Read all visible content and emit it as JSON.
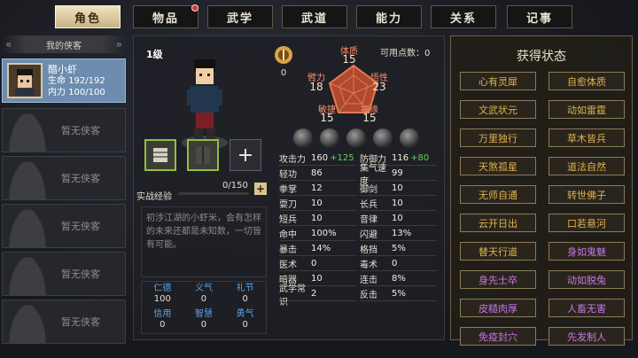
{
  "tabs": [
    {
      "label": "角色",
      "active": true,
      "badge": false
    },
    {
      "label": "物品",
      "active": false,
      "badge": true
    },
    {
      "label": "武学",
      "active": false,
      "badge": false
    },
    {
      "label": "武道",
      "active": false,
      "badge": false
    },
    {
      "label": "能力",
      "active": false,
      "badge": false
    },
    {
      "label": "关系",
      "active": false,
      "badge": false
    },
    {
      "label": "记事",
      "active": false,
      "badge": false
    }
  ],
  "sidebar": {
    "header": "我的侠客",
    "selected": {
      "name": "醋小虾",
      "life_label": "生命",
      "life_value": "192/192",
      "mana_label": "内力",
      "mana_value": "100/100"
    },
    "empty_label": "暂无侠客"
  },
  "character": {
    "level": "1级",
    "badge_value": "0",
    "available_points_label": "可用点数：",
    "available_points": "0",
    "stats": {
      "tizhi": {
        "name": "体质",
        "value": "15"
      },
      "biili": {
        "name": "臂力",
        "value": "18"
      },
      "wuxing": {
        "name": "悟性",
        "value": "23"
      },
      "minjie": {
        "name": "敏捷",
        "value": "15"
      },
      "fuyuan": {
        "name": "福缘",
        "value": "15"
      }
    },
    "exp": {
      "label": "实战经验",
      "value": "0/150",
      "progress": 0.0
    },
    "description": "初涉江湖的小虾米，会有怎样的未来还都是未知数，一切皆有可能。",
    "virtues": [
      {
        "name": "仁德",
        "value": "100"
      },
      {
        "name": "义气",
        "value": "0"
      },
      {
        "name": "礼节",
        "value": "0"
      },
      {
        "name": "信用",
        "value": "0"
      },
      {
        "name": "智慧",
        "value": "0"
      },
      {
        "name": "勇气",
        "value": "0"
      }
    ],
    "attributes": [
      {
        "name": "攻击力",
        "value": "160",
        "bonus": "+125"
      },
      {
        "name": "防御力",
        "value": "116",
        "bonus": "+80"
      },
      {
        "name": "轻功",
        "value": "86",
        "bonus": ""
      },
      {
        "name": "集气速度",
        "value": "99",
        "bonus": ""
      },
      {
        "name": "拳掌",
        "value": "12",
        "bonus": ""
      },
      {
        "name": "御剑",
        "value": "10",
        "bonus": ""
      },
      {
        "name": "耍刀",
        "value": "10",
        "bonus": ""
      },
      {
        "name": "长兵",
        "value": "10",
        "bonus": ""
      },
      {
        "name": "短兵",
        "value": "10",
        "bonus": ""
      },
      {
        "name": "音律",
        "value": "10",
        "bonus": ""
      },
      {
        "name": "命中",
        "value": "100%",
        "bonus": ""
      },
      {
        "name": "闪避",
        "value": "13%",
        "bonus": ""
      },
      {
        "name": "暴击",
        "value": "14%",
        "bonus": ""
      },
      {
        "name": "格挡",
        "value": "5%",
        "bonus": ""
      },
      {
        "name": "医术",
        "value": "0",
        "bonus": ""
      },
      {
        "name": "毒术",
        "value": "0",
        "bonus": ""
      },
      {
        "name": "暗器",
        "value": "10",
        "bonus": ""
      },
      {
        "name": "连击",
        "value": "8%",
        "bonus": ""
      },
      {
        "name": "武学常识",
        "value": "2",
        "bonus": ""
      },
      {
        "name": "反击",
        "value": "5%",
        "bonus": ""
      }
    ]
  },
  "states": {
    "title": "获得状态",
    "items": [
      {
        "label": "心有灵犀",
        "color": "gold"
      },
      {
        "label": "自愈体质",
        "color": "gold"
      },
      {
        "label": "文武状元",
        "color": "gold"
      },
      {
        "label": "动如雷霆",
        "color": "gold"
      },
      {
        "label": "万里独行",
        "color": "gold"
      },
      {
        "label": "草木皆兵",
        "color": "gold"
      },
      {
        "label": "天煞孤星",
        "color": "gold"
      },
      {
        "label": "道法自然",
        "color": "gold"
      },
      {
        "label": "无师自通",
        "color": "gold"
      },
      {
        "label": "转世佛子",
        "color": "gold"
      },
      {
        "label": "云开日出",
        "color": "gold"
      },
      {
        "label": "口若悬河",
        "color": "gold"
      },
      {
        "label": "替天行道",
        "color": "gold"
      },
      {
        "label": "身如鬼魅",
        "color": "purple"
      },
      {
        "label": "身先士卒",
        "color": "purple"
      },
      {
        "label": "动如脱兔",
        "color": "purple"
      },
      {
        "label": "皮糙肉厚",
        "color": "purple"
      },
      {
        "label": "人畜无害",
        "color": "purple"
      },
      {
        "label": "免疫封穴",
        "color": "purple"
      },
      {
        "label": "先发制人",
        "color": "purple"
      }
    ]
  },
  "colors": {
    "gold": "#e0b24e",
    "purple": "#c576e6",
    "bonus": "#5fcf5a",
    "stat_name": "#ff8a6a"
  }
}
